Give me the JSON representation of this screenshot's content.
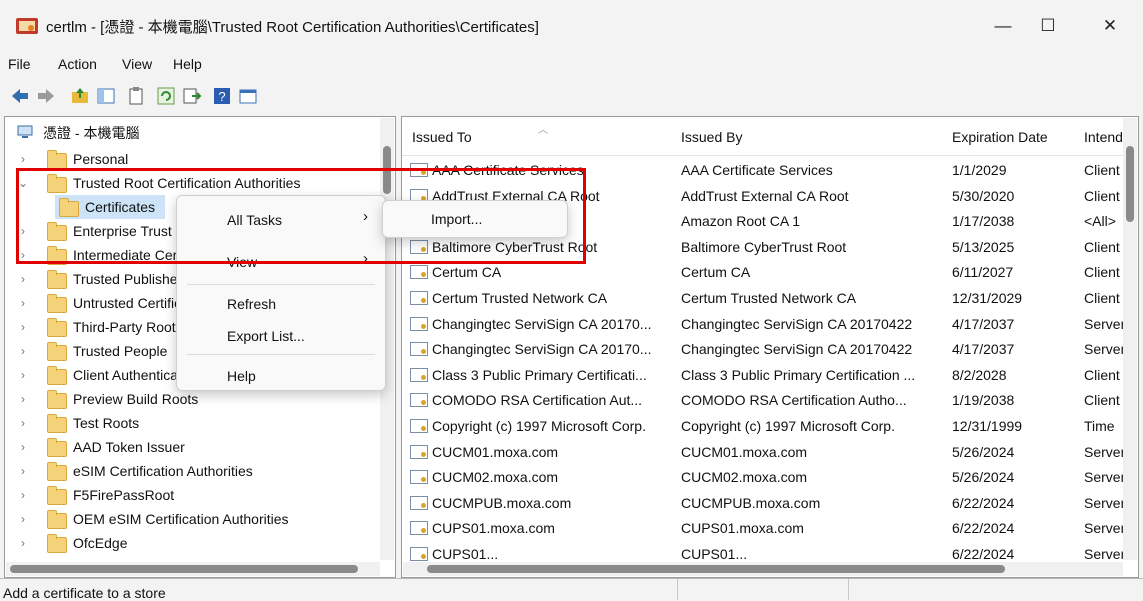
{
  "window": {
    "title": "certlm - [憑證 - 本機電腦\\Trusted Root Certification Authorities\\Certificates]",
    "minimize_glyph": "—",
    "maximize_glyph": "☐",
    "close_glyph": "✕"
  },
  "menu": [
    "File",
    "Action",
    "View",
    "Help"
  ],
  "toolbar_icons": [
    "back-arrow-icon",
    "forward-arrow-icon",
    "up-folder-icon",
    "show-hide-tree-icon",
    "clipboard-icon",
    "refresh-icon",
    "export-list-icon",
    "help-icon",
    "properties-icon"
  ],
  "tree": {
    "root": "憑證 - 本機電腦",
    "items": [
      {
        "label": "Personal",
        "expanded": false
      },
      {
        "label": "Trusted Root Certification Authorities",
        "expanded": true
      },
      {
        "label": "Certificates",
        "child": true,
        "selected": true
      },
      {
        "label": "Enterprise Trust",
        "expanded": false
      },
      {
        "label": "Intermediate Certification Authorities",
        "expanded": false
      },
      {
        "label": "Trusted Publishers",
        "expanded": false
      },
      {
        "label": "Untrusted Certificates",
        "expanded": false
      },
      {
        "label": "Third-Party Root Certification Authorities",
        "expanded": false
      },
      {
        "label": "Trusted People",
        "expanded": false
      },
      {
        "label": "Client Authentication Issuers",
        "expanded": false
      },
      {
        "label": "Preview Build Roots",
        "expanded": false
      },
      {
        "label": "Test Roots",
        "expanded": false
      },
      {
        "label": "AAD Token Issuer",
        "expanded": false
      },
      {
        "label": "eSIM Certification Authorities",
        "expanded": false
      },
      {
        "label": "F5FirePassRoot",
        "expanded": false
      },
      {
        "label": "OEM eSIM Certification Authorities",
        "expanded": false
      },
      {
        "label": "OfcEdge",
        "expanded": false
      }
    ]
  },
  "list": {
    "columns": [
      "Issued To",
      "Issued By",
      "Expiration Date",
      "Intended Purposes"
    ],
    "rows": [
      [
        "AAA Certificate Services",
        "AAA Certificate Services",
        "1/1/2029",
        "Client"
      ],
      [
        "AddTrust External CA Root",
        "AddTrust External CA Root",
        "5/30/2020",
        "Client"
      ],
      [
        "Amazon Root CA 1",
        "Amazon Root CA 1",
        "1/17/2038",
        "<All>"
      ],
      [
        "Baltimore CyberTrust Root",
        "Baltimore CyberTrust Root",
        "5/13/2025",
        "Client"
      ],
      [
        "Certum CA",
        "Certum CA",
        "6/11/2027",
        "Client"
      ],
      [
        "Certum Trusted Network CA",
        "Certum Trusted Network CA",
        "12/31/2029",
        "Client"
      ],
      [
        "Changingtec ServiSign CA 20170...",
        "Changingtec ServiSign CA 20170422",
        "4/17/2037",
        "Server"
      ],
      [
        "Changingtec ServiSign CA 20170...",
        "Changingtec ServiSign CA 20170422",
        "4/17/2037",
        "Server"
      ],
      [
        "Class 3 Public Primary Certificati...",
        "Class 3 Public Primary Certification ...",
        "8/2/2028",
        "Client"
      ],
      [
        "COMODO RSA Certification Aut...",
        "COMODO RSA Certification Autho...",
        "1/19/2038",
        "Client"
      ],
      [
        "Copyright (c) 1997 Microsoft Corp.",
        "Copyright (c) 1997 Microsoft Corp.",
        "12/31/1999",
        "Time"
      ],
      [
        "CUCM01.moxa.com",
        "CUCM01.moxa.com",
        "5/26/2024",
        "Server"
      ],
      [
        "CUCM02.moxa.com",
        "CUCM02.moxa.com",
        "5/26/2024",
        "Server"
      ],
      [
        "CUCMPUB.moxa.com",
        "CUCMPUB.moxa.com",
        "6/22/2024",
        "Server"
      ],
      [
        "CUPS01.moxa.com",
        "CUPS01.moxa.com",
        "6/22/2024",
        "Server"
      ],
      [
        "CUPS01...",
        "CUPS01...",
        "6/22/2024",
        "Server"
      ]
    ]
  },
  "context_menu": {
    "items": [
      "All Tasks",
      "View",
      "Refresh",
      "Export List...",
      "Help"
    ],
    "submenu_arrow": "›"
  },
  "submenu": {
    "items": [
      "Import..."
    ]
  },
  "status": "Add a certificate to a store",
  "colors": {
    "highlight_box": "#e00000",
    "selection": "#cde3f7"
  }
}
